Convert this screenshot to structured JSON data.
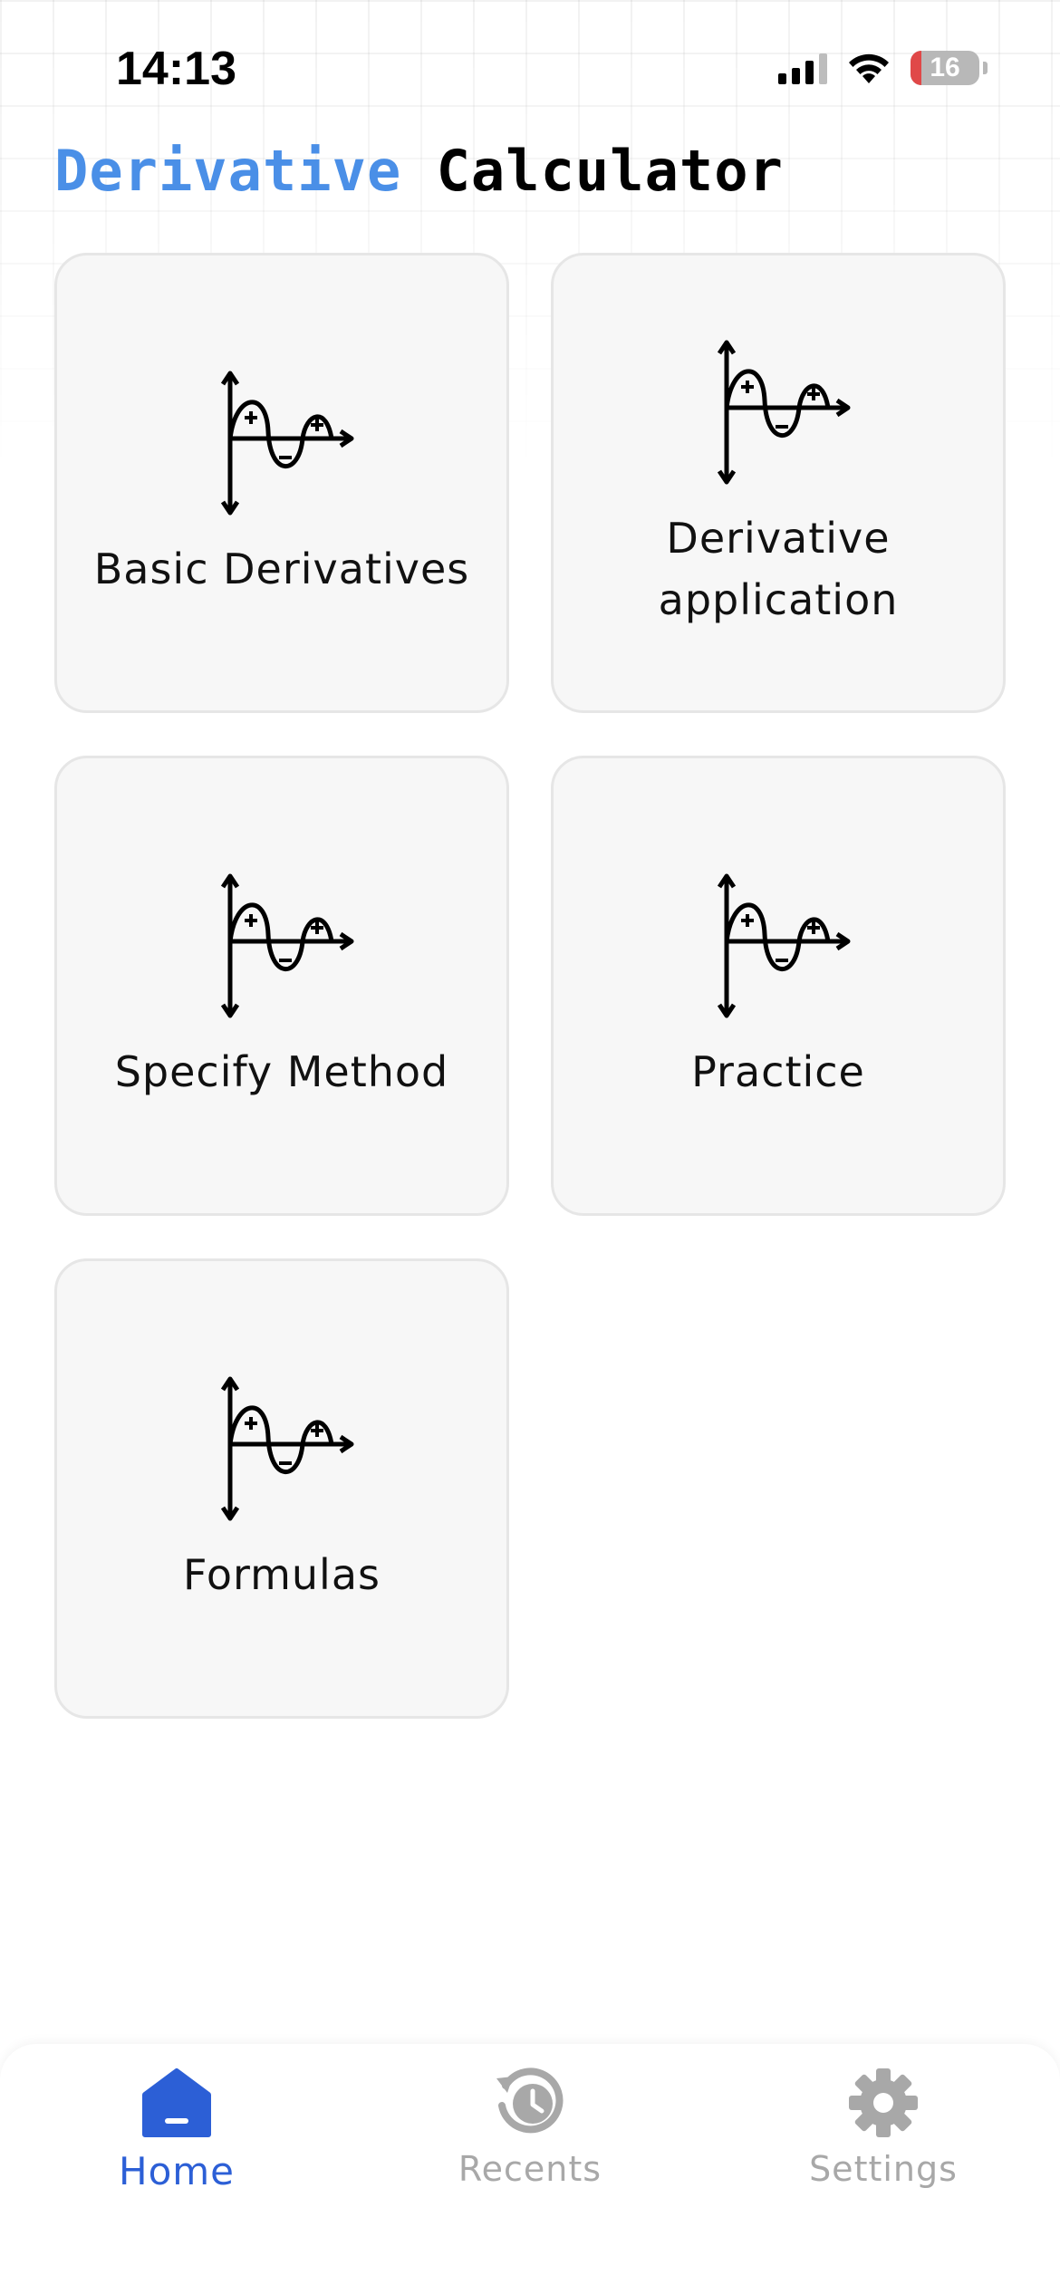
{
  "status_bar": {
    "time": "14:13",
    "battery_level": "16",
    "battery_color": "#e04848"
  },
  "header": {
    "title_accent": "Derivative",
    "title_main": "Calculator",
    "accent_color": "#4a8fe7"
  },
  "cards": [
    {
      "label": "Basic Derivatives",
      "icon": "derivative-graph-icon"
    },
    {
      "label": "Derivative application",
      "icon": "derivative-graph-icon"
    },
    {
      "label": "Specify Method",
      "icon": "derivative-graph-icon"
    },
    {
      "label": "Practice",
      "icon": "derivative-graph-icon"
    },
    {
      "label": "Formulas",
      "icon": "derivative-graph-icon"
    }
  ],
  "tab_bar": {
    "active_color": "#2c5fd6",
    "inactive_color": "#a8a8a8",
    "tabs": [
      {
        "label": "Home",
        "icon": "home-icon",
        "active": true
      },
      {
        "label": "Recents",
        "icon": "history-icon",
        "active": false
      },
      {
        "label": "Settings",
        "icon": "gear-icon",
        "active": false
      }
    ]
  }
}
